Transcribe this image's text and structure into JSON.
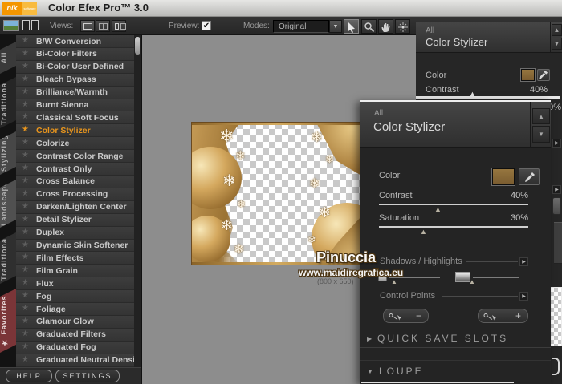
{
  "titlebar": {
    "logo_nik": "nik",
    "logo_software": "software",
    "title": "Color Efex Pro™ 3.0"
  },
  "toolbar": {
    "views_label": "Views:",
    "preview_label": "Preview:",
    "preview_checked": true,
    "modes_label": "Modes:",
    "modes_value": "Original Image"
  },
  "sidebar": {
    "tabs": [
      {
        "label": "All"
      },
      {
        "label": "Traditional"
      },
      {
        "label": "Stylizing"
      },
      {
        "label": "Landscape"
      },
      {
        "label": "Traditional"
      },
      {
        "label": "Favorites"
      }
    ],
    "filters": [
      "B/W Conversion",
      "Bi-Color Filters",
      "Bi-Color User Defined",
      "Bleach Bypass",
      "Brilliance/Warmth",
      "Burnt Sienna",
      "Classical Soft Focus",
      "Color Stylizer",
      "Colorize",
      "Contrast Color Range",
      "Contrast Only",
      "Cross Balance",
      "Cross Processing",
      "Darken/Lighten Center",
      "Detail Stylizer",
      "Duplex",
      "Dynamic Skin Softener",
      "Film Effects",
      "Film Grain",
      "Flux",
      "Fog",
      "Foliage",
      "Glamour Glow",
      "Graduated Filters",
      "Graduated Fog",
      "Graduated Neutral Density"
    ],
    "selected_filter": "Color Stylizer"
  },
  "bottombar": {
    "help": "HELP",
    "settings": "SETTINGS"
  },
  "canvas": {
    "caption": "(800 x 650)"
  },
  "watermark": {
    "line1": "Pinuccia",
    "line2": "www.maidiregrafica.eu"
  },
  "panel": {
    "category": "All",
    "title": "Color Stylizer",
    "color_label": "Color",
    "contrast_label": "Contrast",
    "contrast_value": "40%",
    "saturation_label": "Saturation",
    "saturation_value": "30%",
    "shadows_highlights_label": "Shadows / Highlights",
    "control_points_label": "Control Points",
    "quick_save_slots_label": "QUICK SAVE SLOTS",
    "loupe_label": "LOUPE"
  },
  "icons": {
    "star": "★",
    "snowflake": "❄",
    "check": "✔",
    "up": "▲",
    "down": "▼",
    "right": "▶",
    "triangle": "▲",
    "minus": "−",
    "plus": "+"
  },
  "colors": {
    "accent_orange": "#e8951d",
    "favorites_red": "#7b3538",
    "swatch_brown": "#8a6a3b",
    "canvas_gray": "#8d8d8d",
    "logo_orange": "#f49600"
  }
}
